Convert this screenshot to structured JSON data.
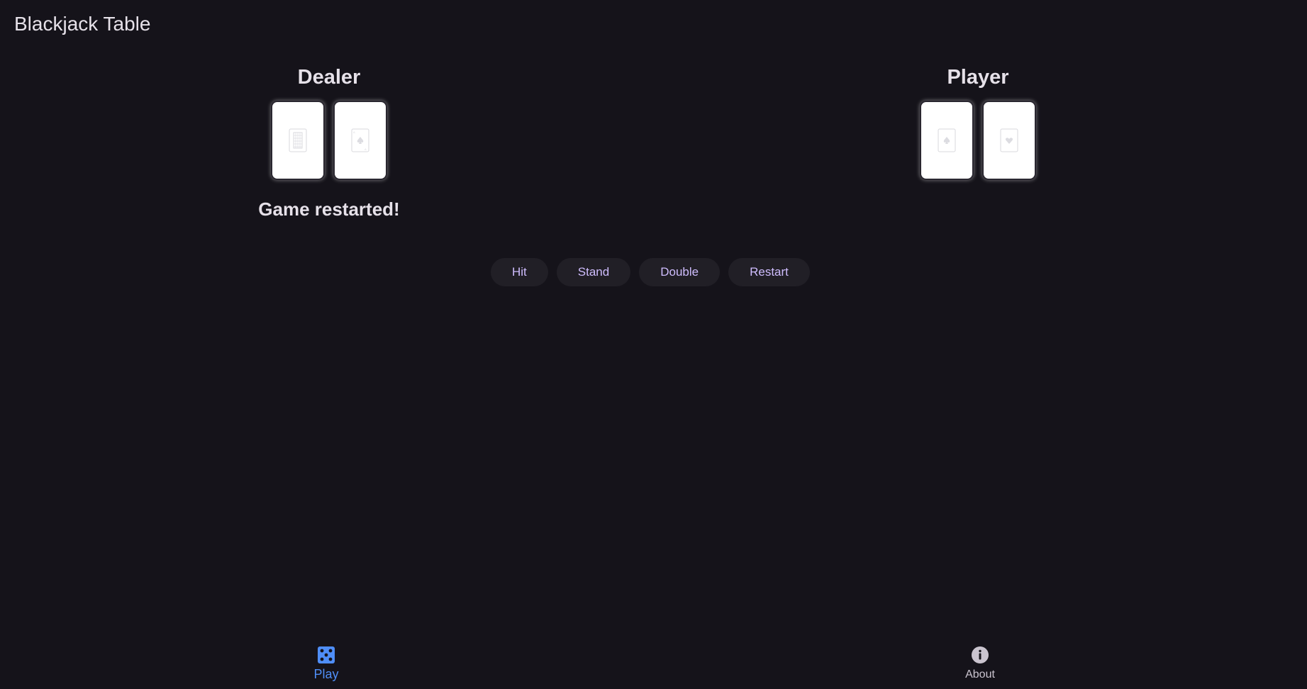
{
  "app": {
    "title": "Blackjack Table"
  },
  "dealer": {
    "title": "Dealer",
    "cards": [
      {
        "icon": "card-back-icon"
      },
      {
        "icon": "card-spade-icon"
      }
    ]
  },
  "player": {
    "title": "Player",
    "cards": [
      {
        "icon": "card-spade-icon"
      },
      {
        "icon": "card-heart-icon"
      }
    ]
  },
  "status": {
    "message": "Game restarted!"
  },
  "actions": {
    "hit": "Hit",
    "stand": "Stand",
    "double": "Double",
    "restart": "Restart"
  },
  "nav": {
    "play": {
      "label": "Play",
      "icon": "dice-icon",
      "active": true
    },
    "about": {
      "label": "About",
      "icon": "info-icon",
      "active": false
    }
  },
  "colors": {
    "background": "#15131a",
    "button_bg": "#211f26",
    "button_text": "#cfbdfe",
    "active_nav": "#4f8ef7",
    "inactive_nav": "#cac4cf",
    "card_face": "#ffffff"
  }
}
